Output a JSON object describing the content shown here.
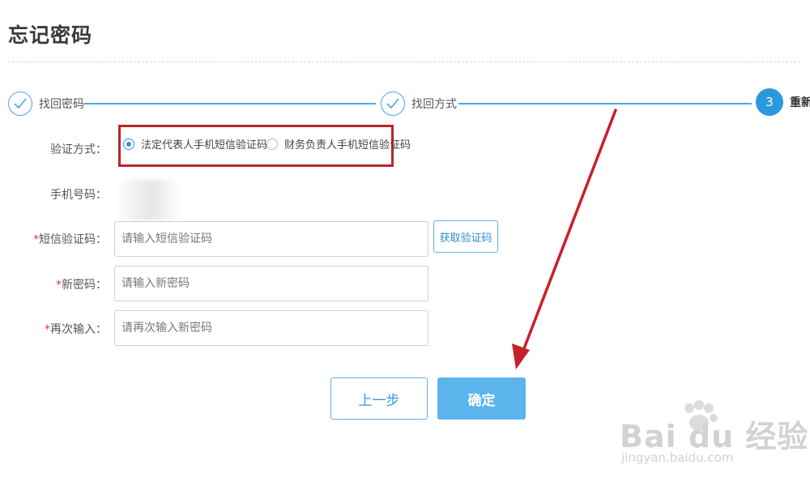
{
  "page": {
    "title": "忘记密码"
  },
  "steps": [
    {
      "label": "找回密码",
      "state": "done"
    },
    {
      "label": "找回方式",
      "state": "done"
    },
    {
      "number": "3",
      "label": "重新设",
      "state": "active"
    }
  ],
  "form": {
    "verify_method": {
      "label": "验证方式",
      "options": [
        {
          "label": "法定代表人手机短信验证码",
          "checked": true
        },
        {
          "label": "财务负责人手机短信验证码",
          "checked": false
        }
      ]
    },
    "phone": {
      "label": "手机号码"
    },
    "sms_code": {
      "label": "短信验证码",
      "required_mark": "*",
      "placeholder": "请输入短信验证码",
      "button_label": "获取验证码"
    },
    "new_password": {
      "label": "新密码",
      "required_mark": "*",
      "placeholder": "请输入新密码"
    },
    "confirm_password": {
      "label": "再次输入",
      "required_mark": "*",
      "placeholder": "请再次输入新密码"
    }
  },
  "actions": {
    "prev_label": "上一步",
    "confirm_label": "确定"
  },
  "watermark": {
    "main": "Bai du 经验",
    "sub": "jingyan.baidu.com"
  },
  "colors": {
    "accent": "#2a97de",
    "highlight_box": "#b8262c",
    "arrow": "#c8202a",
    "required": "#e4393c"
  }
}
